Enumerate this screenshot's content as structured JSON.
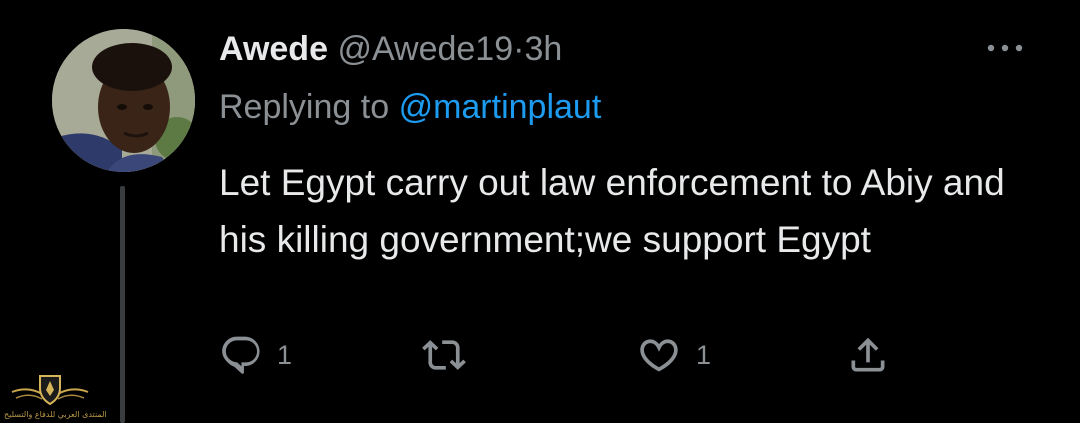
{
  "tweet": {
    "display_name": "Awede",
    "handle": "@Awede19",
    "separator": "·",
    "time": "3h",
    "replying_prefix": "Replying to",
    "replying_mention": "@martinplaut",
    "text": "Let Egypt carry out law enforcement to Abiy and his killing government;we support Egypt"
  },
  "actions": {
    "reply_count": "1",
    "like_count": "1"
  },
  "watermark": {
    "text": "المنتدى العربي للدفاع والتسليح"
  },
  "colors": {
    "background": "#000000",
    "primary_text": "#e7e9ea",
    "secondary_text": "#8b9095",
    "mention": "#1d9bf0",
    "thread_line": "#3a3d40"
  },
  "icons": [
    "more-icon",
    "reply-icon",
    "retweet-icon",
    "like-icon",
    "share-icon",
    "watermark-logo-icon"
  ]
}
